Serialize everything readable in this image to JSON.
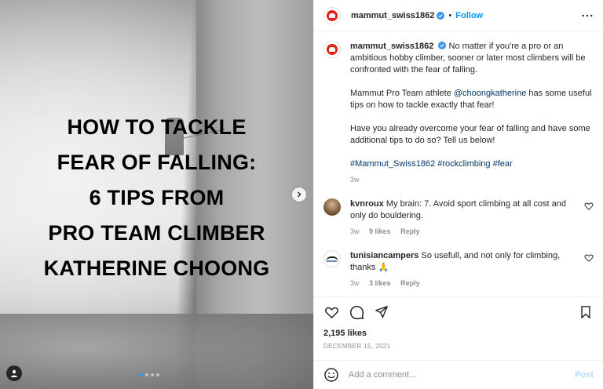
{
  "media": {
    "headline": [
      "HOW TO TACKLE",
      "FEAR OF FALLING:",
      "6 TIPS FROM",
      "PRO TEAM CLIMBER",
      "KATHERINE CHOONG"
    ],
    "carousel_dots": 4,
    "active_dot": 0
  },
  "header": {
    "username": "mammut_swiss1862",
    "separator": "•",
    "follow_label": "Follow",
    "more_icon": "more-horizontal-icon"
  },
  "caption": {
    "username": "mammut_swiss1862",
    "paragraph1": "No matter if you're a pro or an ambitious hobby climber, sooner or later most climbers will be confronted with the fear of falling.",
    "paragraph2_pre": "Mammut Pro Team athlete ",
    "mention": "@choongkatherine",
    "paragraph2_post": " has some useful tips on how to tackle exactly that fear!",
    "paragraph3": "Have you already overcome your fear of falling and have some additional tips to do so? Tell us below!",
    "hashtags": [
      "#Mammut_Swiss1862",
      "#rockclimbing",
      "#fear"
    ],
    "time": "3w"
  },
  "comments": [
    {
      "username": "kvnroux",
      "text": "My brain: 7. Avoid sport climbing at all cost and only do bouldering.",
      "time": "3w",
      "likes": "9 likes",
      "reply": "Reply"
    },
    {
      "username": "tunisiancampers",
      "text": "So usefull, and not only for climbing, thanks 🙏",
      "time": "3w",
      "likes": "3 likes",
      "reply": "Reply"
    }
  ],
  "actions": {
    "likes": "2,195 likes",
    "date": "DECEMBER 15, 2021"
  },
  "add_comment": {
    "placeholder": "Add a comment...",
    "post_label": "Post"
  },
  "colors": {
    "accent": "#0095f6",
    "link": "#00376b",
    "muted": "#8e8e8e",
    "brand": "#e2231a"
  }
}
